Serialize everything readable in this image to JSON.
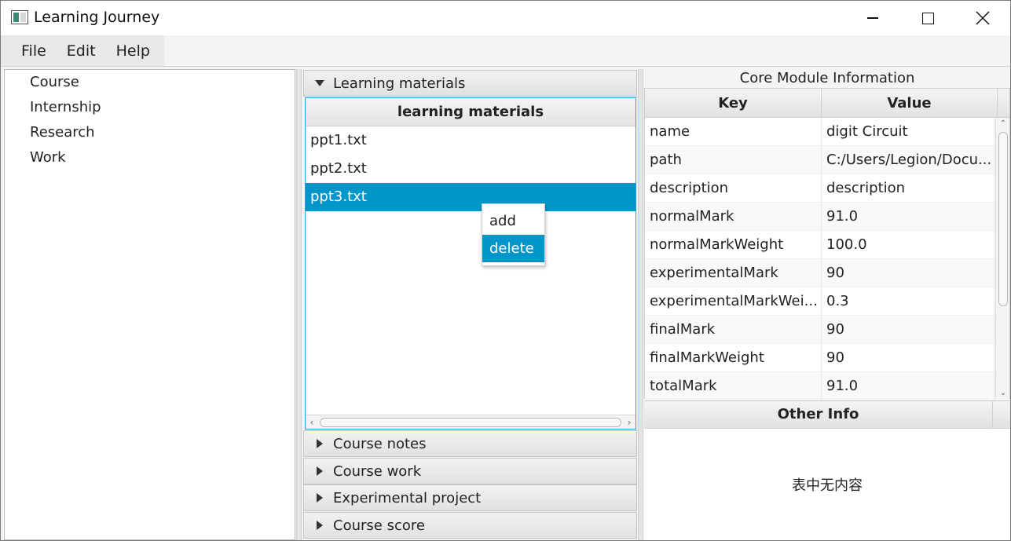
{
  "window": {
    "title": "Learning Journey"
  },
  "menu": {
    "items": [
      "File",
      "Edit",
      "Help"
    ]
  },
  "tree": {
    "items": [
      "Course",
      "Internship",
      "Research",
      "Work"
    ]
  },
  "accordion": {
    "expanded": {
      "title": "Learning materials",
      "list_header": "learning materials",
      "items": [
        "ppt1.txt",
        "ppt2.txt",
        "ppt3.txt"
      ],
      "selected_index": 2
    },
    "collapsed": [
      "Course notes",
      "Course work",
      "Experimental project",
      "Course score"
    ]
  },
  "context_menu": {
    "items": [
      "add",
      "delete"
    ],
    "active": "delete"
  },
  "info_panel": {
    "title": "Core Module Information",
    "columns": [
      "Key",
      "Value"
    ],
    "rows": [
      {
        "key": "name",
        "value": "digit Circuit"
      },
      {
        "key": "path",
        "value": "C:/Users/Legion/Docu..."
      },
      {
        "key": "description",
        "value": "description"
      },
      {
        "key": "normalMark",
        "value": "91.0"
      },
      {
        "key": "normalMarkWeight",
        "value": "100.0"
      },
      {
        "key": "experimentalMark",
        "value": "90"
      },
      {
        "key": "experimentalMarkWei...",
        "value": "0.3"
      },
      {
        "key": "finalMark",
        "value": "90"
      },
      {
        "key": "finalMarkWeight",
        "value": "90"
      },
      {
        "key": "totalMark",
        "value": "91.0"
      }
    ],
    "other_info_header": "Other Info",
    "other_info_empty": "表中无内容"
  },
  "colors": {
    "selection": "#0096c9",
    "focus_border": "#2a9fd6"
  }
}
